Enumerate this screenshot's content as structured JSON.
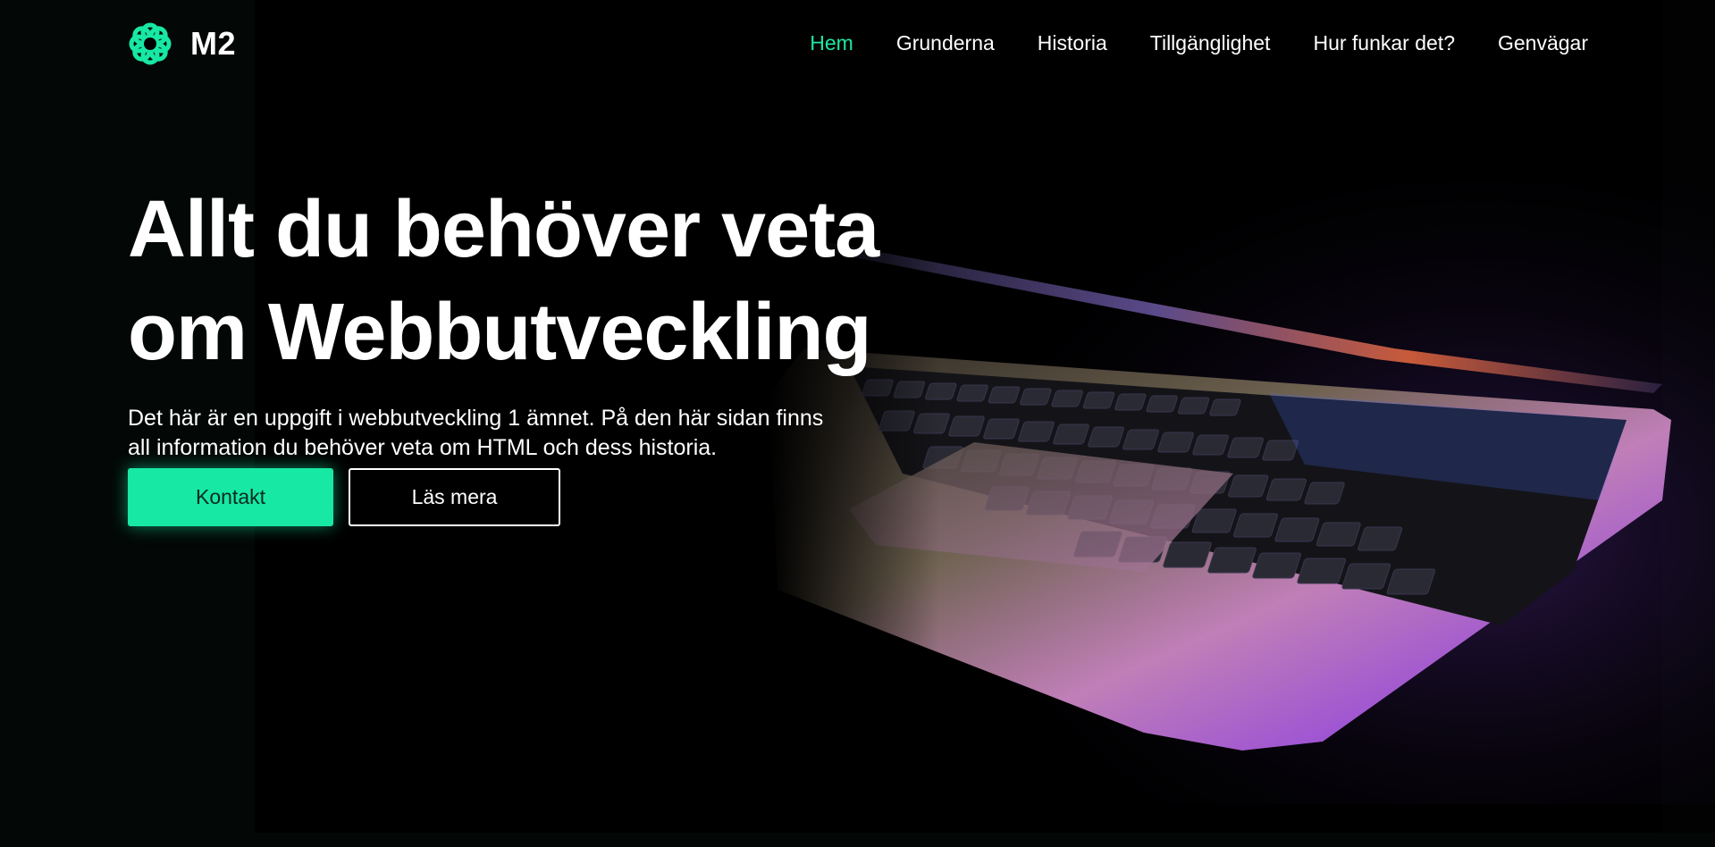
{
  "brand": {
    "name": "M2",
    "logo_icon": "flower-icon",
    "accent_color": "#17e8a4"
  },
  "nav": {
    "items": [
      {
        "label": "Hem",
        "active": true
      },
      {
        "label": "Grunderna",
        "active": false
      },
      {
        "label": "Historia",
        "active": false
      },
      {
        "label": "Tillgänglighet",
        "active": false
      },
      {
        "label": "Hur funkar det?",
        "active": false
      },
      {
        "label": "Genvägar",
        "active": false
      }
    ]
  },
  "hero": {
    "title_line1": "Allt du behöver veta",
    "title_line2": "om Webbutveckling",
    "lead_line1": "Det här är en uppgift i webbutveckling 1 ämnet. På den här sidan finns",
    "lead_line2": "all information du behöver veta om HTML och dess historia.",
    "primary_button": "Kontakt",
    "secondary_button": "Läs mera",
    "image": "laptop-keyboard-image"
  }
}
